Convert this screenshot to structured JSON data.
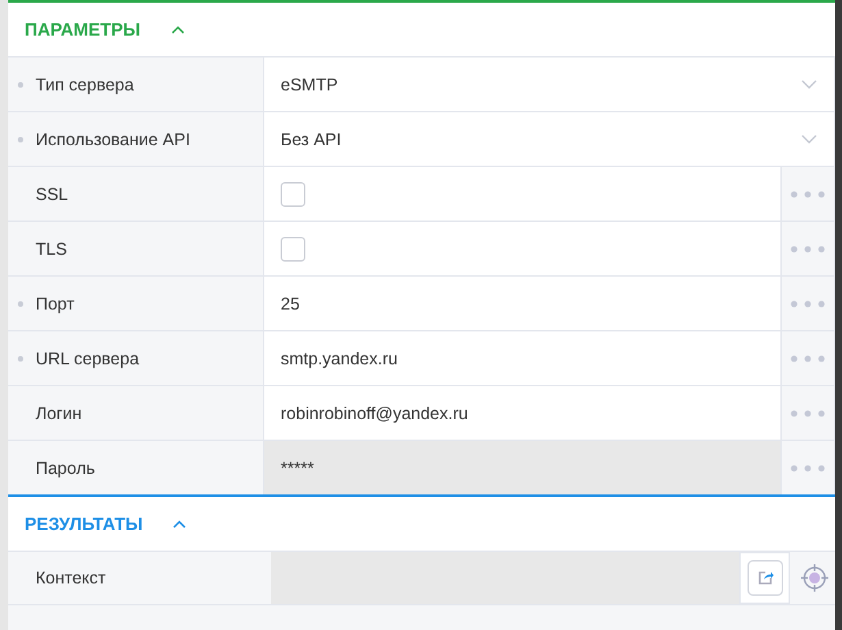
{
  "sections": [
    {
      "title": "ПАРАМЕТРЫ",
      "color": "#2aa84a",
      "expanded": true,
      "rows": [
        {
          "label": "Тип сервера",
          "required": true,
          "kind": "select",
          "value": "eSMTP"
        },
        {
          "label": "Использование API",
          "required": true,
          "kind": "select",
          "value": "Без API"
        },
        {
          "label": "SSL",
          "required": false,
          "kind": "checkbox",
          "checked": false
        },
        {
          "label": "TLS",
          "required": false,
          "kind": "checkbox",
          "checked": false
        },
        {
          "label": "Порт",
          "required": true,
          "kind": "text",
          "value": "25"
        },
        {
          "label": "URL сервера",
          "required": true,
          "kind": "text",
          "value": "smtp.yandex.ru"
        },
        {
          "label": "Логин",
          "required": false,
          "kind": "text",
          "value": "robinrobinoff@yandex.ru"
        },
        {
          "label": "Пароль",
          "required": false,
          "kind": "readonly",
          "value": "*****"
        }
      ]
    },
    {
      "title": "РЕЗУЛЬТАТЫ",
      "color": "#1e8fe6",
      "expanded": true,
      "rows": [
        {
          "label": "Контекст",
          "required": false,
          "kind": "output"
        }
      ]
    }
  ]
}
